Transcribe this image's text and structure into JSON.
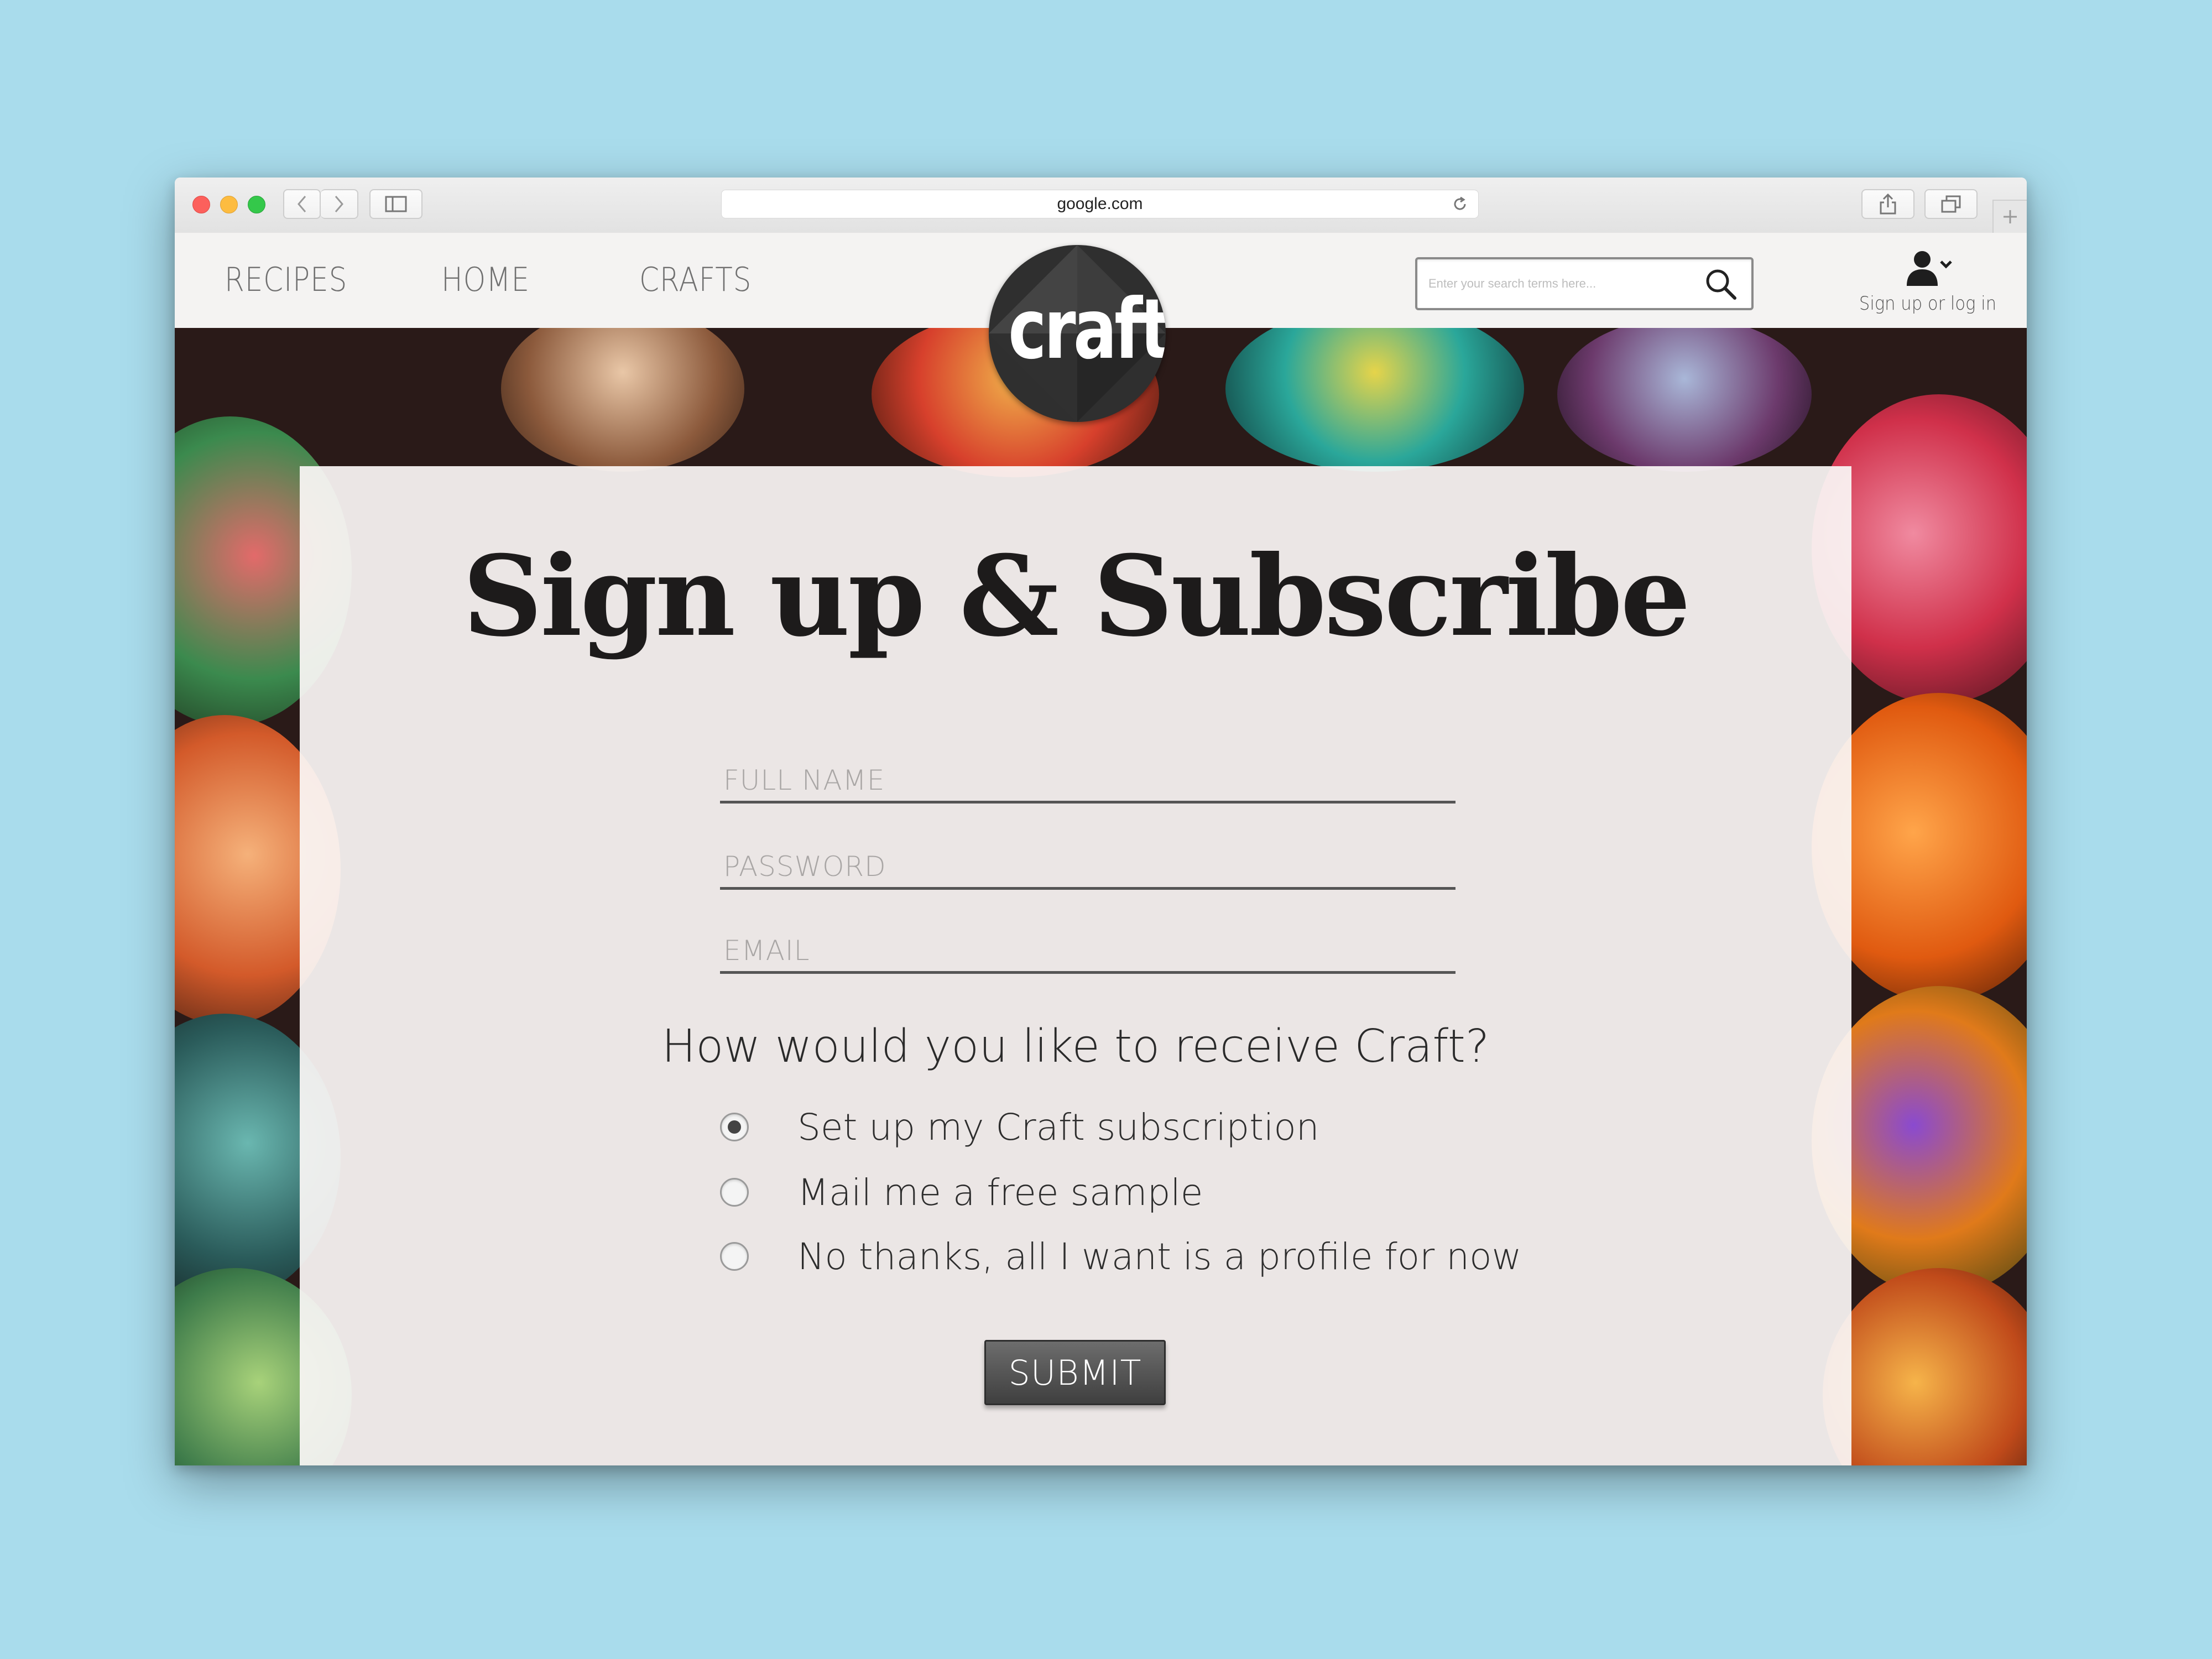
{
  "browser": {
    "url": "google.com"
  },
  "nav": {
    "items": [
      {
        "label": "RECIPES"
      },
      {
        "label": "HOME"
      },
      {
        "label": "CRAFTS"
      }
    ]
  },
  "logo": {
    "text": "craft"
  },
  "search": {
    "placeholder": "Enter your search terms here..."
  },
  "account": {
    "label": "Sign up or log in",
    "icon": "user-icon"
  },
  "form": {
    "title": "Sign up & Subscribe",
    "fields": [
      {
        "placeholder": "FULL NAME",
        "value": ""
      },
      {
        "placeholder": "PASSWORD",
        "value": ""
      },
      {
        "placeholder": "EMAIL",
        "value": ""
      }
    ],
    "question": "How would you like to receive Craft?",
    "options": [
      {
        "label": "Set up my Craft subscription",
        "selected": true
      },
      {
        "label": "Mail me a free sample",
        "selected": false
      },
      {
        "label": "No thanks, all I want is a profile for now",
        "selected": false
      }
    ],
    "submit_label": "SUBMIT"
  },
  "colors": {
    "background": "#a9dcec",
    "submit": "#4f4f4f",
    "logo": "#2f2f2f"
  }
}
